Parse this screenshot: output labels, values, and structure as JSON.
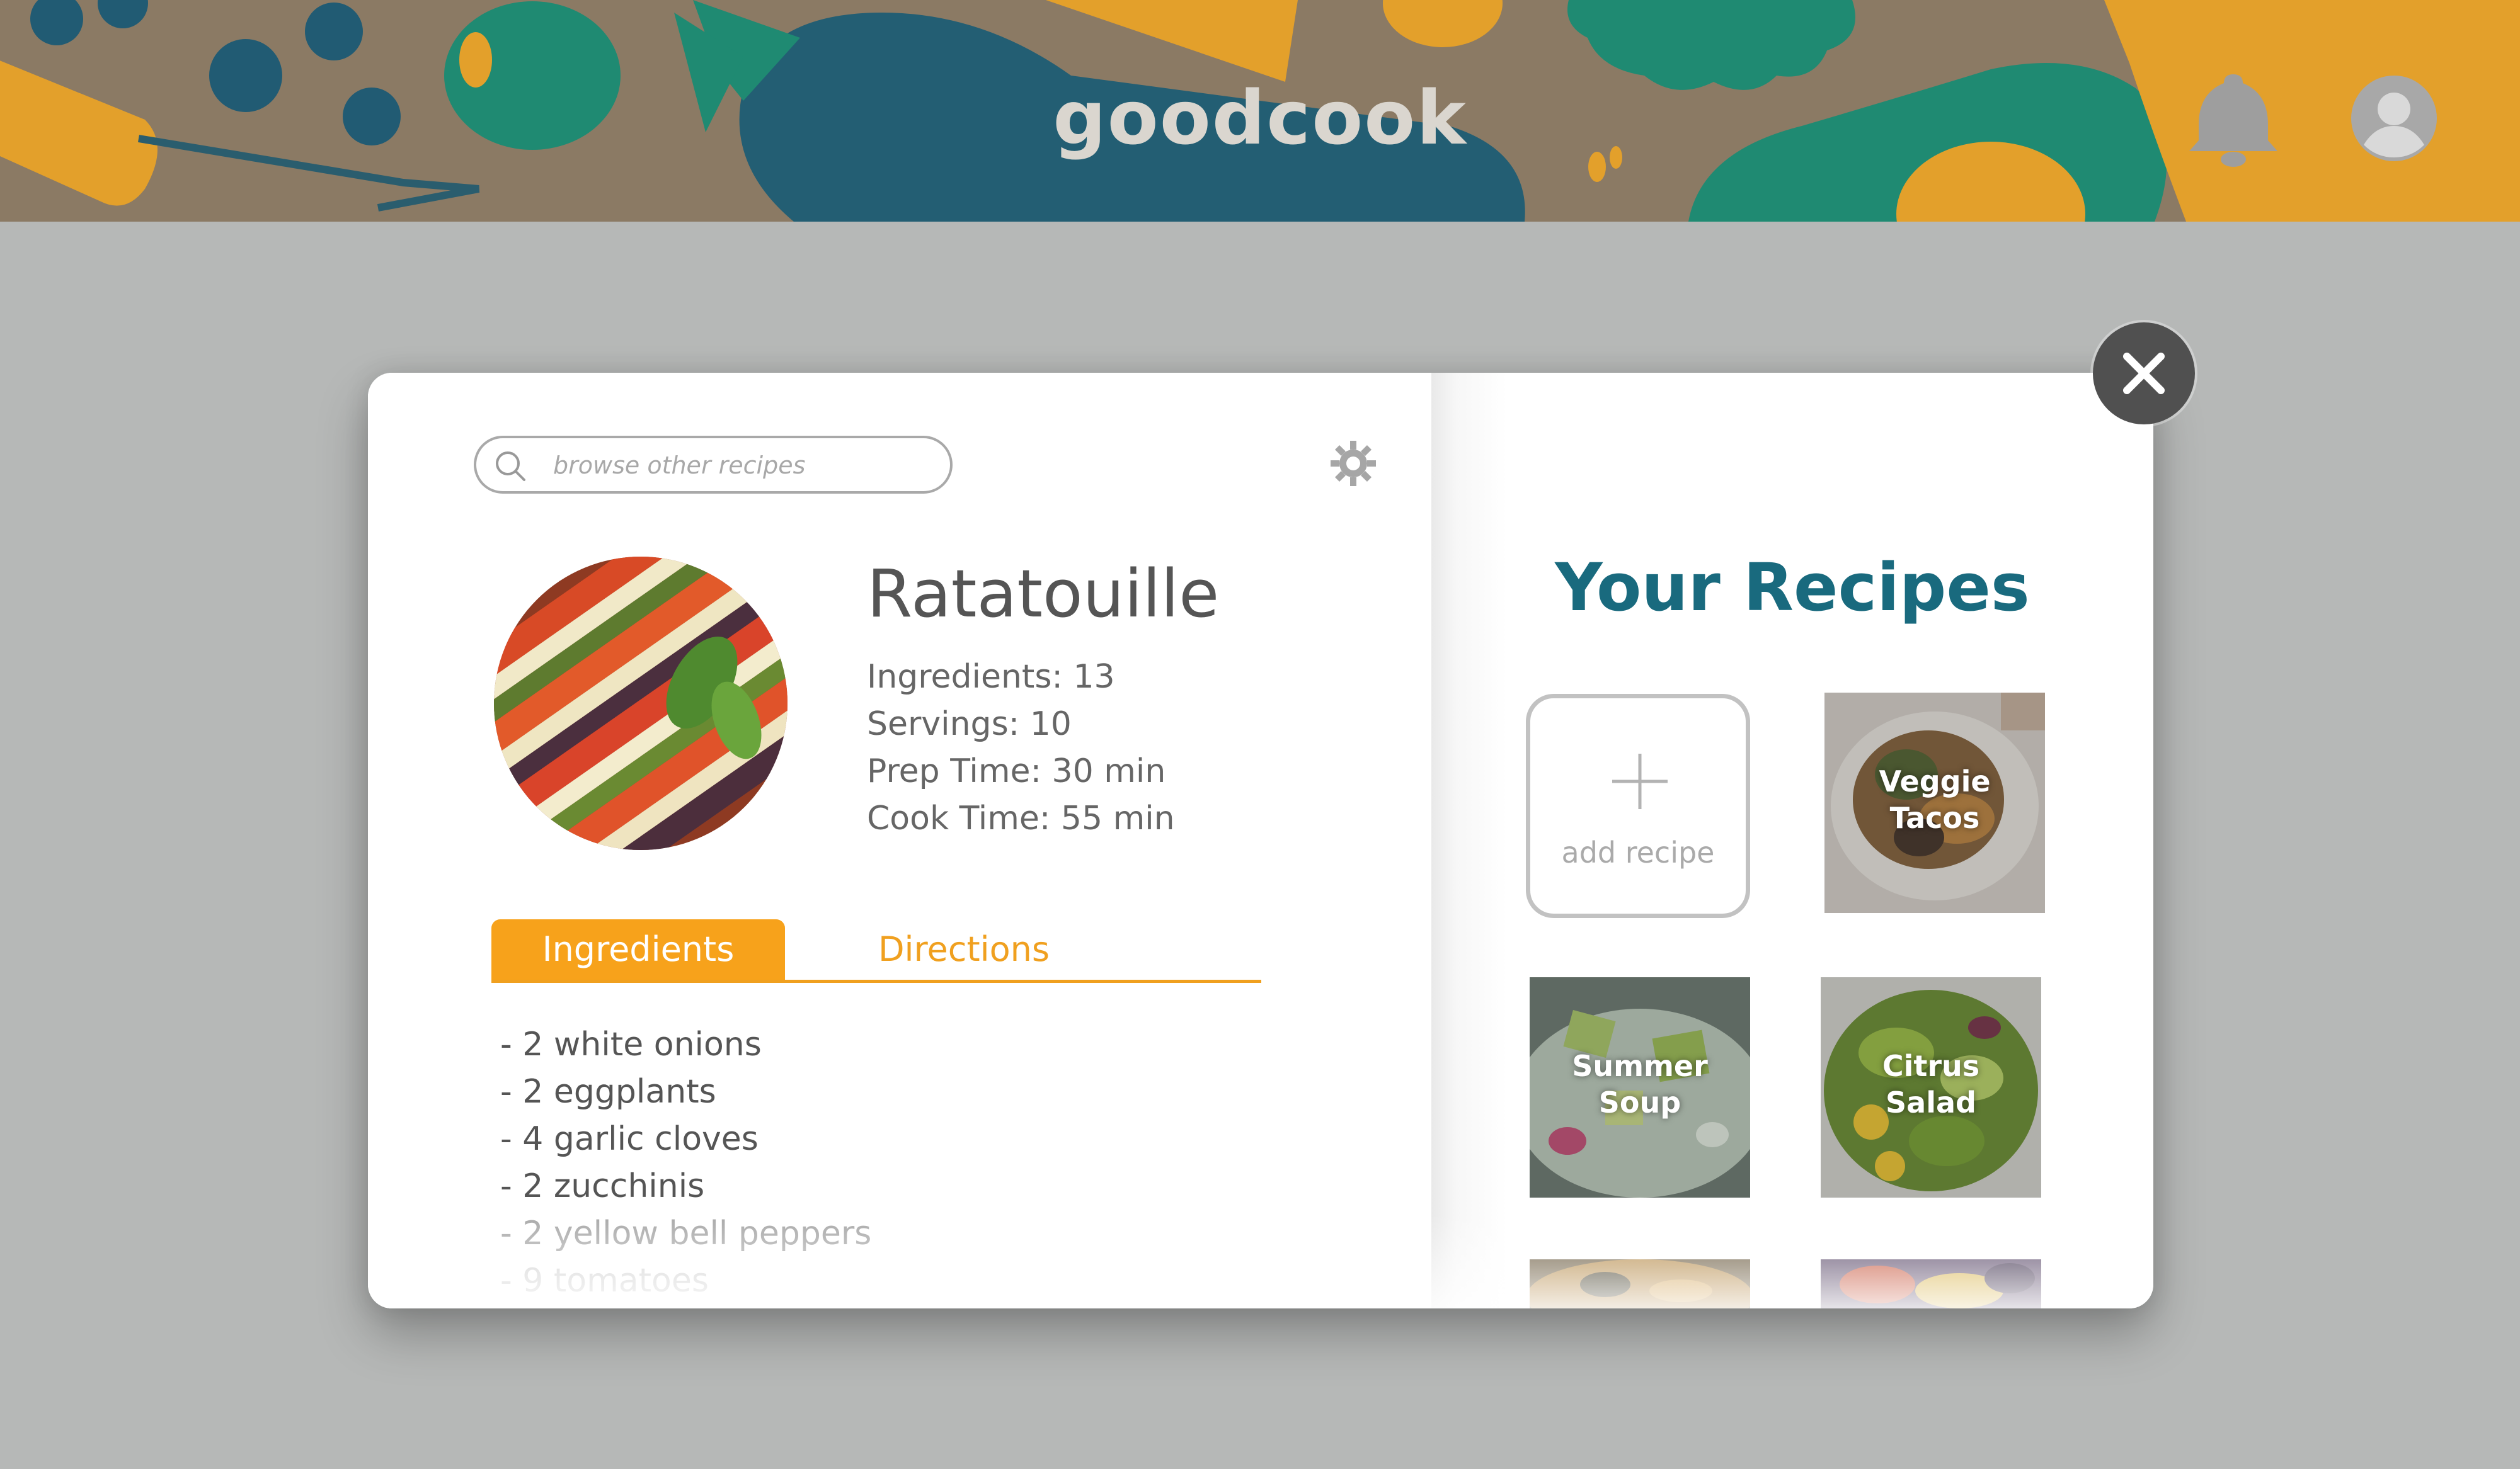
{
  "header": {
    "brand": "goodcook",
    "icons": [
      "bell-icon",
      "avatar-icon"
    ]
  },
  "modal": {
    "search": {
      "placeholder": "browse other recipes"
    },
    "settings_icon": "gear-icon",
    "recipe": {
      "title": "Ratatouille",
      "ingredients_count": "Ingredients: 13",
      "servings": "Servings: 10",
      "prep_time": "Prep Time: 30 min",
      "cook_time": "Cook Time: 55 min"
    },
    "tabs": [
      {
        "label": "Ingredients",
        "active": true
      },
      {
        "label": "Directions",
        "active": false
      }
    ],
    "ingredients": [
      "- 2 white onions",
      "- 2 eggplants",
      "- 4 garlic cloves",
      "- 2 zucchinis",
      "- 2 yellow bell peppers",
      "- 9 tomatoes"
    ],
    "your_recipes": {
      "title": "Your Recipes",
      "add_label": "add recipe",
      "cards": [
        {
          "line1": "Veggie",
          "line2": "Tacos"
        },
        {
          "line1": "Summer",
          "line2": "Soup"
        },
        {
          "line1": "Citrus",
          "line2": "Salad"
        },
        {
          "line1": "",
          "line2": ""
        },
        {
          "line1": "",
          "line2": ""
        }
      ]
    },
    "close_icon": "close-icon"
  },
  "colors": {
    "accent_orange": "#f7a21b",
    "title_teal": "#196a7e",
    "header_bg": "#8b7a64"
  }
}
